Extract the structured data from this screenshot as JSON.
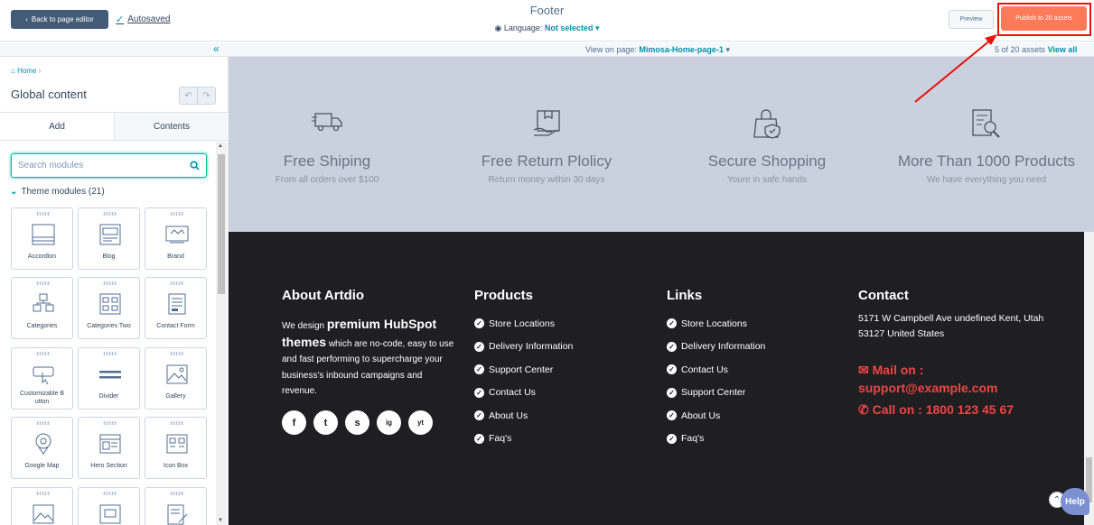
{
  "topbar": {
    "back_label": "Back to page editor",
    "autosaved_label": "Autosaved",
    "title": "Footer",
    "language_label": "Language:",
    "language_value": "Not selected",
    "preview_label": "Preview",
    "publish_label": "Publish to 20 assets"
  },
  "viewbar": {
    "view_on_page_label": "View on page:",
    "view_on_page_value": "Mimosa-Home-page-1",
    "assets_count": "5 of 20 assets",
    "view_all": "View all"
  },
  "sidebar": {
    "breadcrumb": "Home",
    "title": "Global content",
    "tabs": [
      "Add",
      "Contents"
    ],
    "search_placeholder": "Search modules",
    "section_label": "Theme modules",
    "section_count": "(21)",
    "modules": [
      "Accordion",
      "Blog",
      "Brand",
      "Categories",
      "Categories Two",
      "Contact Form",
      "Customizable B utton",
      "Divider",
      "Gallery",
      "Google Map",
      "Hero Section",
      "Icon Box",
      "",
      "",
      ""
    ]
  },
  "features": [
    {
      "title": "Free Shiping",
      "sub": "From all orders over $100",
      "icon": "truck-icon"
    },
    {
      "title": "Free Return Plolicy",
      "sub": "Return money within 30 days",
      "icon": "return-box-icon"
    },
    {
      "title": "Secure Shopping",
      "sub": "Youre in safe hands",
      "icon": "secure-bag-icon"
    },
    {
      "title": "More Than 1000 Products",
      "sub": "We have everything you need",
      "icon": "products-doc-icon"
    }
  ],
  "footer": {
    "about": {
      "title": "About Artdio",
      "text_1": "We design",
      "bold": "premium HubSpot themes",
      "text_2": "which are no-code, easy to use and fast performing to supercharge your business's inbound campaigns and revenue."
    },
    "social": [
      "f",
      "t",
      "s",
      "ig",
      "yt"
    ],
    "products": {
      "title": "Products",
      "items": [
        "Store Locations",
        "Delivery Information",
        "Support Center",
        "Contact Us",
        "About Us",
        "Faq's"
      ]
    },
    "links": {
      "title": "Links",
      "items": [
        "Store Locations",
        "Delivery Information",
        "Contact Us",
        "Support Center",
        "About Us",
        "Faq's"
      ]
    },
    "contact": {
      "title": "Contact",
      "address": "5171 W Campbell Ave undefined Kent, Utah 53127 United States",
      "mail": "Mail on : support@example.com",
      "call": "Call on : 1800 123 45 67"
    }
  },
  "help_label": "Help",
  "colors": {
    "publish": "#ff7a59",
    "accent": "#0091ae",
    "footer_bg": "#1f1f21",
    "contact_red": "#f04343",
    "annotation": "#e8120c"
  }
}
